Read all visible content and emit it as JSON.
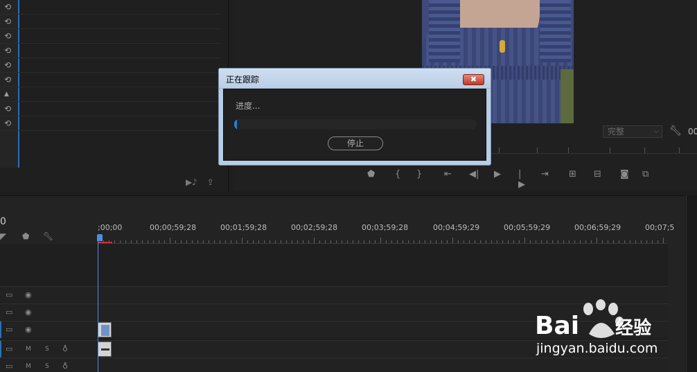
{
  "left_panel": {
    "rows": [
      "⟲",
      "⟲",
      "⟲",
      "⟲",
      "⟲",
      "⟲",
      "▲",
      "⟲",
      "⟲"
    ]
  },
  "monitor": {
    "quality": "完整",
    "timecode_partial": "00"
  },
  "dialog": {
    "title": "正在跟踪",
    "close_label": "✖",
    "progress_label": "进度...",
    "progress_value": 0.01,
    "stop_label": "停止"
  },
  "timeline": {
    "timecode_partial": "0",
    "ruler_labels": [
      ";00;00",
      "00;00;59;28",
      "00;01;59;28",
      "00;02;59;28",
      "00;03;59;28",
      "00;04;59;29",
      "00;05;59;29",
      "00;06;59;29",
      "00;07;5"
    ],
    "tracks": [
      {
        "kind": "video",
        "m": "",
        "s": ""
      },
      {
        "kind": "video",
        "m": "",
        "s": ""
      },
      {
        "kind": "video",
        "m": "",
        "s": ""
      },
      {
        "kind": "audio",
        "m": "M",
        "s": "S"
      },
      {
        "kind": "audio",
        "m": "M",
        "s": "S"
      }
    ]
  },
  "watermark": {
    "logo_text": "Bai",
    "logo_text2": "经验",
    "site": "jingyan.baidu.com"
  },
  "colors": {
    "accent": "#2b7de0",
    "dialog_title_bg": "#b9cee6",
    "close_red": "#c0392b"
  }
}
